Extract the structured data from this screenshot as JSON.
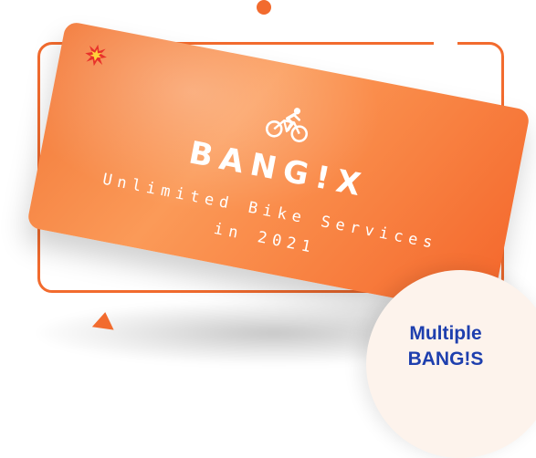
{
  "card": {
    "brand": "BANG!X",
    "tagline_line1": "Unlimited Bike Services",
    "tagline_line2": "in 2021",
    "icons": [
      "spark-icon",
      "bicycle-rider-icon"
    ]
  },
  "badge": {
    "line1": "Multiple",
    "line2": "BANG!S"
  },
  "colors": {
    "accent": "#f26b2e",
    "card_gradient_start": "#f37a3a",
    "card_gradient_end": "#f4672c",
    "badge_background": "#fdf3ec",
    "badge_text": "#1e3fae"
  }
}
